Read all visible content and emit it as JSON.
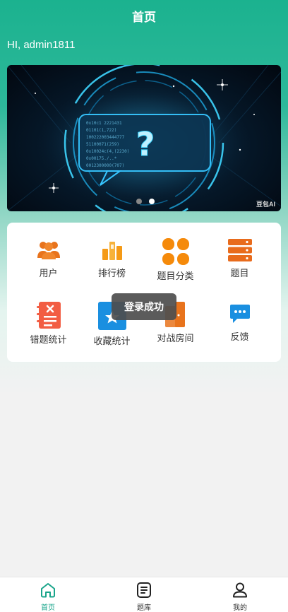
{
  "header": {
    "title": "首页"
  },
  "greeting": "HI, admin1811",
  "banner": {
    "watermark": "豆包AI",
    "slide_count": 2,
    "active_slide": 2
  },
  "grid": {
    "items": [
      {
        "label": "用户",
        "icon": "users-icon",
        "color": "#e8731c"
      },
      {
        "label": "排行榜",
        "icon": "ranking-icon",
        "color": "#f59a16"
      },
      {
        "label": "题目分类",
        "icon": "category-icon",
        "color": "#f58a0b"
      },
      {
        "label": "题目",
        "icon": "question-list-icon",
        "color": "#e86b1c"
      },
      {
        "label": "错题统计",
        "icon": "wrong-questions-icon",
        "color": "#f25d43"
      },
      {
        "label": "收藏统计",
        "icon": "favorites-icon",
        "color": "#1a8fe0"
      },
      {
        "label": "对战房间",
        "icon": "battle-room-icon",
        "color": "#e8731c"
      },
      {
        "label": "反馈",
        "icon": "feedback-icon",
        "color": "#1a8fe0"
      }
    ]
  },
  "toast": "登录成功",
  "tabbar": {
    "tabs": [
      {
        "label": "首页",
        "icon": "home-icon",
        "active": true
      },
      {
        "label": "题库",
        "icon": "question-bank-icon",
        "active": false
      },
      {
        "label": "我的",
        "icon": "profile-icon",
        "active": false
      }
    ],
    "active_color": "#1aa58b"
  }
}
